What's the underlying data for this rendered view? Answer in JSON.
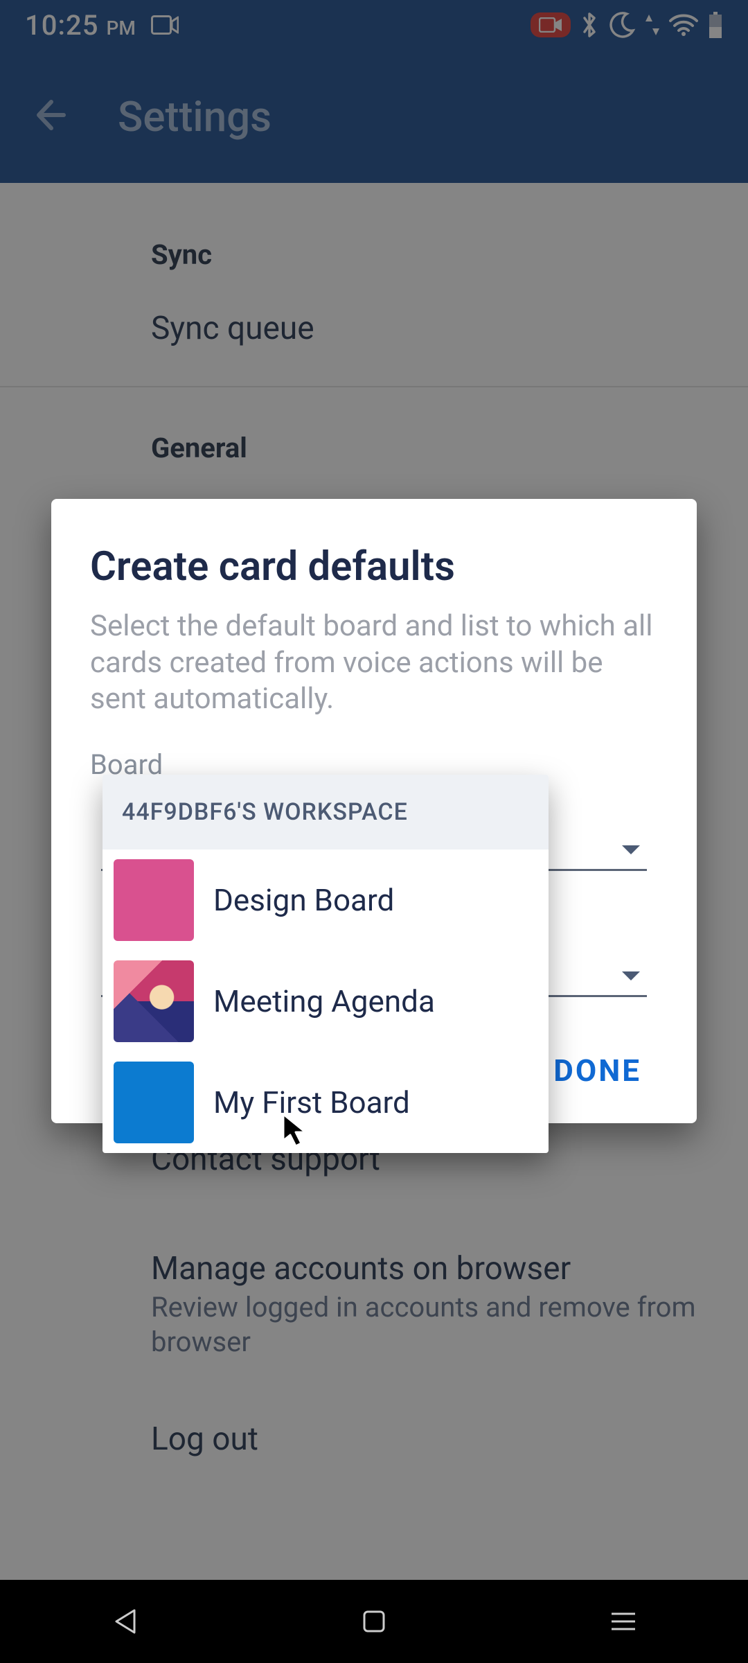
{
  "status": {
    "time": "10:25",
    "ampm": "PM"
  },
  "appbar": {
    "title": "Settings"
  },
  "settings": {
    "sync_header": "Sync",
    "sync_queue": "Sync queue",
    "general_header": "General",
    "contact_support": "Contact support",
    "manage_title": "Manage accounts on browser",
    "manage_sub": "Review logged in accounts and remove from browser",
    "log_out": "Log out"
  },
  "dialog": {
    "title": "Create card defaults",
    "desc": "Select the default board and list to which all cards created from voice actions will be sent automatically.",
    "board_label": "Board",
    "done": "DONE"
  },
  "dropdown": {
    "workspace": "44F9DBF6'S WORKSPACE",
    "items": [
      {
        "label": "Design Board"
      },
      {
        "label": "Meeting Agenda"
      },
      {
        "label": "My First Board"
      }
    ]
  }
}
